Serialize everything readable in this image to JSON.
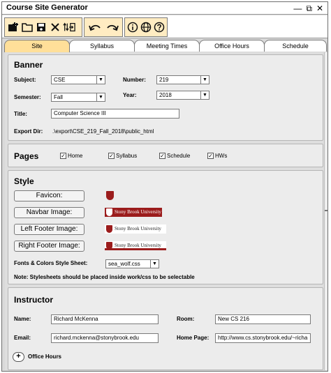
{
  "window": {
    "title": "Course Site Generator",
    "controls": [
      "—",
      "⧉",
      "✕"
    ]
  },
  "toolbar": {
    "file_icons": [
      "new-file-icon",
      "open-folder-icon",
      "save-icon",
      "exit-icon",
      "export-icon"
    ],
    "edit_icons": [
      "undo-icon",
      "redo-icon"
    ],
    "help_icons": [
      "info-icon",
      "language-icon",
      "help-icon"
    ]
  },
  "tabs": [
    {
      "label": "Site",
      "active": true
    },
    {
      "label": "Syllabus",
      "active": false
    },
    {
      "label": "Meeting Times",
      "active": false
    },
    {
      "label": "Office Hours",
      "active": false
    },
    {
      "label": "Schedule",
      "active": false
    }
  ],
  "banner": {
    "heading": "Banner",
    "subject_label": "Subject:",
    "subject_value": "CSE",
    "number_label": "Number:",
    "number_value": "219",
    "semester_label": "Semester:",
    "semester_value": "Fall",
    "year_label": "Year:",
    "year_value": "2018",
    "title_label": "Title:",
    "title_value": "Computer Science III",
    "export_label": "Export Dir:",
    "export_value": ".\\export\\CSE_219_Fall_2018\\public_html"
  },
  "pages": {
    "heading": "Pages",
    "items": [
      {
        "label": "Home",
        "checked": true
      },
      {
        "label": "Syllabus",
        "checked": true
      },
      {
        "label": "Schedule",
        "checked": true
      },
      {
        "label": "HWs",
        "checked": true
      }
    ]
  },
  "style": {
    "heading": "Style",
    "favicon_button": "Favicon:",
    "navbar_button": "Navbar Image:",
    "left_footer_button": "Left Footer Image:",
    "right_footer_button": "Right Footer Image:",
    "logo_text": "Stony Brook University",
    "sheet_label": "Fonts & Colors Style Sheet:",
    "sheet_value": "sea_wolf.css",
    "note": "Note: Stylesheets should be placed inside work/css to be selectable",
    "brand_color": "#9b1c1c"
  },
  "instructor": {
    "heading": "Instructor",
    "name_label": "Name:",
    "name_value": "Richard McKenna",
    "room_label": "Room:",
    "room_value": "New CS 216",
    "email_label": "Email:",
    "email_value": "richard.mckenna@stonybrook.edu",
    "homepage_label": "Home Page:",
    "homepage_value": "http://www.cs.stonybrook.edu/~richa",
    "office_hours_button": "+",
    "office_hours_label": "Office Hours"
  }
}
